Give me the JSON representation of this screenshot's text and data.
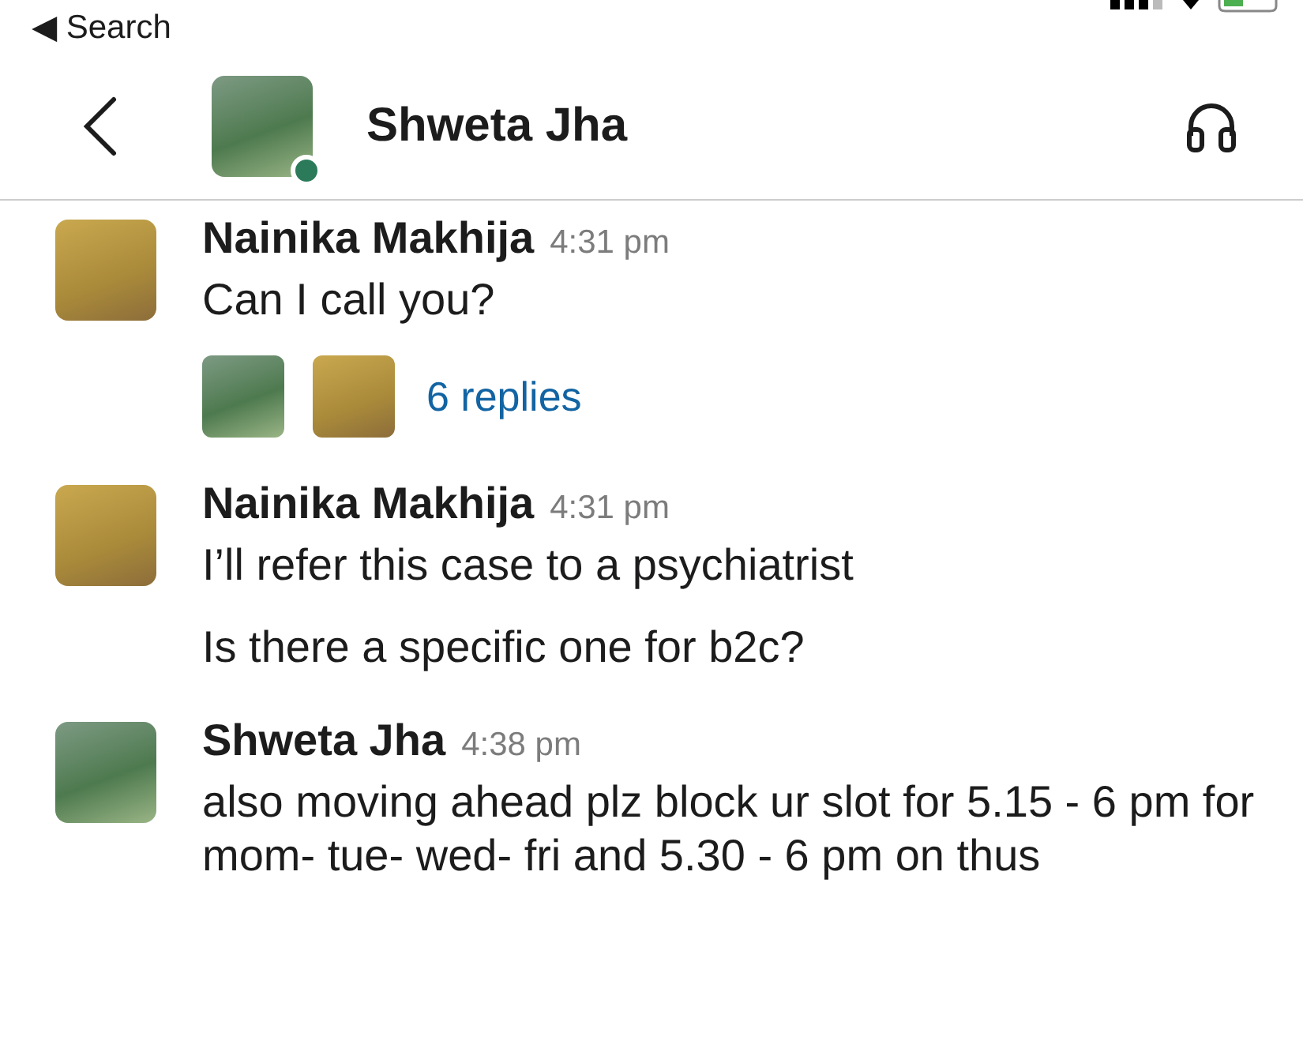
{
  "status_bar": {
    "back_label": "◀ Search"
  },
  "header": {
    "title": "Shweta Jha",
    "avatar": {
      "kind": "lotus"
    },
    "online": true
  },
  "messages": [
    {
      "author": "Nainika Makhija",
      "time": "4:31 pm",
      "avatar": {
        "kind": "person"
      },
      "paragraphs": [
        "Can I call you?"
      ],
      "thread": {
        "avatars": [
          {
            "kind": "lotus"
          },
          {
            "kind": "person"
          }
        ],
        "label": "6 replies"
      }
    },
    {
      "author": "Nainika Makhija",
      "time": "4:31 pm",
      "avatar": {
        "kind": "person"
      },
      "paragraphs": [
        "I’ll refer this case to a psychiatrist",
        "Is there a specific one for b2c?"
      ]
    },
    {
      "author": "Shweta Jha",
      "time": "4:38 pm",
      "avatar": {
        "kind": "lotus"
      },
      "paragraphs": [
        "also moving ahead plz block ur slot for 5.15 - 6 pm for mom- tue- wed- fri and 5.30 - 6 pm on thus"
      ]
    }
  ]
}
